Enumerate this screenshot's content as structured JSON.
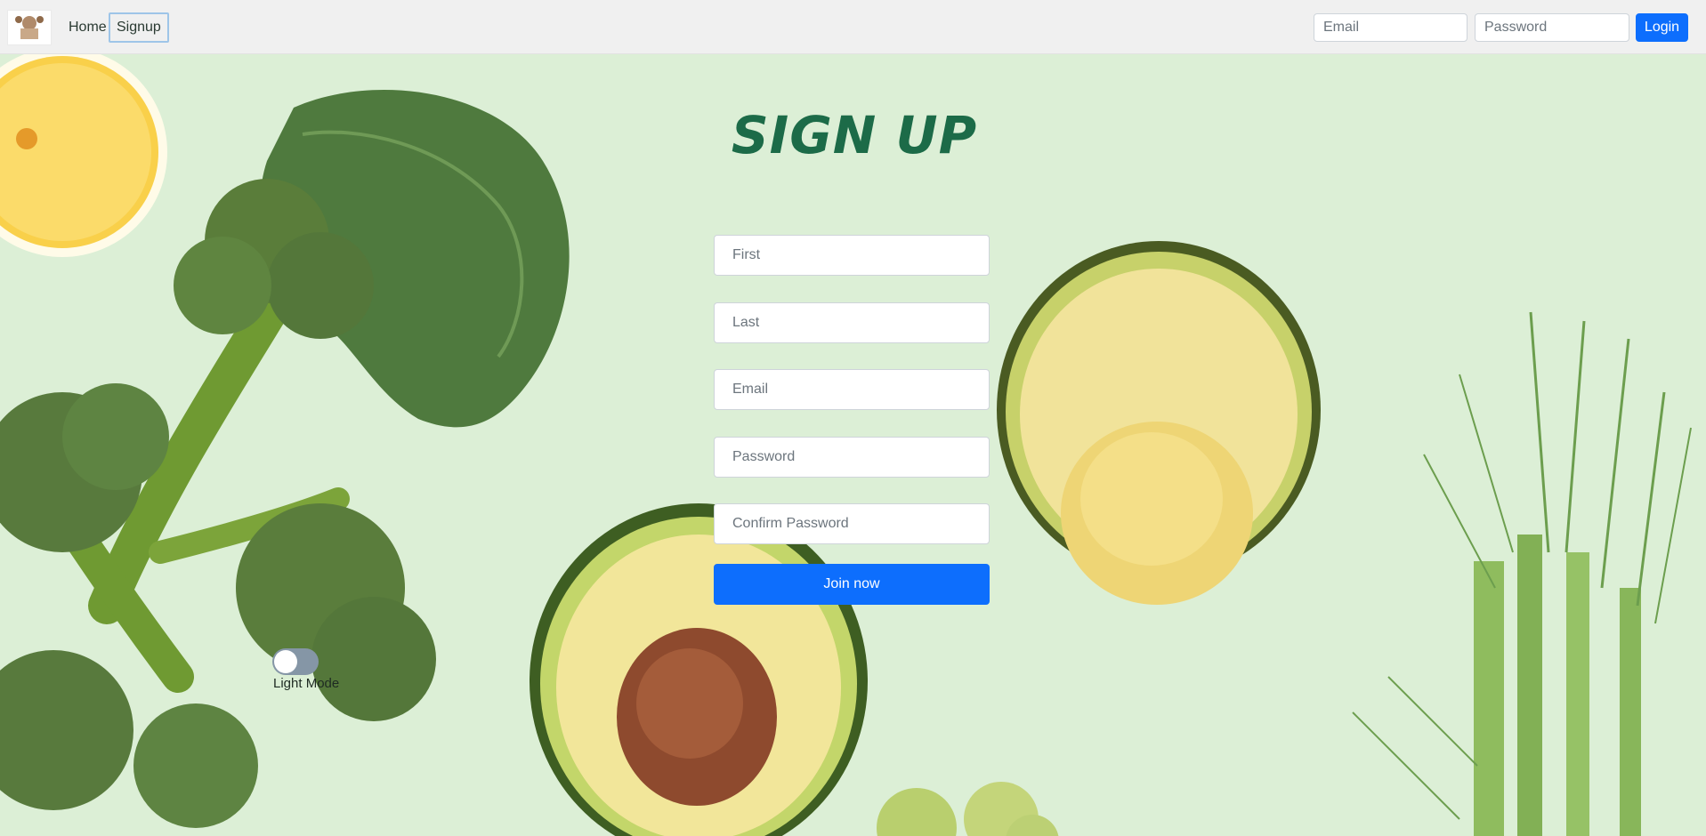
{
  "nav": {
    "home_label": "Home",
    "signup_label": "Signup",
    "email_placeholder": "Email",
    "password_placeholder": "Password",
    "login_label": "Login"
  },
  "form": {
    "title": "SIGN UP",
    "first_placeholder": "First",
    "last_placeholder": "Last",
    "email_placeholder": "Email",
    "password_placeholder": "Password",
    "confirm_placeholder": "Confirm Password",
    "submit_label": "Join now"
  },
  "theme_toggle": {
    "label": "Light Mode",
    "state": "off"
  },
  "colors": {
    "accent": "#0d6efd",
    "title": "#1c6b48",
    "background": "#dcefd6"
  }
}
